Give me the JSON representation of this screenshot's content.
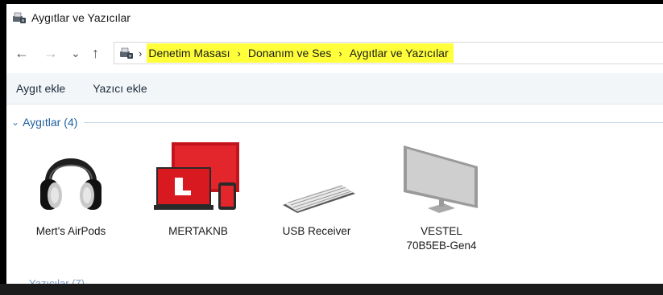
{
  "window": {
    "title": "Aygıtlar ve Yazıcılar"
  },
  "nav": {
    "back": "←",
    "forward": "→",
    "recent": "⌄",
    "up": "↑"
  },
  "address": {
    "separator": "›",
    "crumbs": [
      "Denetim Masası",
      "Donanım ve Ses",
      "Aygıtlar ve Yazıcılar"
    ],
    "highlight_color": "#ffff3a"
  },
  "toolbar": {
    "add_device": "Aygıt ekle",
    "add_printer": "Yazıcı ekle"
  },
  "groups": [
    {
      "title": "Aygıtlar",
      "count": "(4)",
      "chevron": "⌄"
    },
    {
      "title": "Yazıcılar (7)"
    }
  ],
  "devices": [
    {
      "name": "Mert's AirPods",
      "icon": "headphones-icon"
    },
    {
      "name": "MERTAKNB",
      "icon": "computer-icon"
    },
    {
      "name": "USB Receiver",
      "icon": "keyboard-icon"
    },
    {
      "name_line1": "VESTEL",
      "name_line2": "70B5EB-Gen4",
      "icon": "monitor-icon"
    }
  ],
  "colors": {
    "group_title": "#1e5fa0",
    "toolbar_bg": "#f3f6f9"
  }
}
